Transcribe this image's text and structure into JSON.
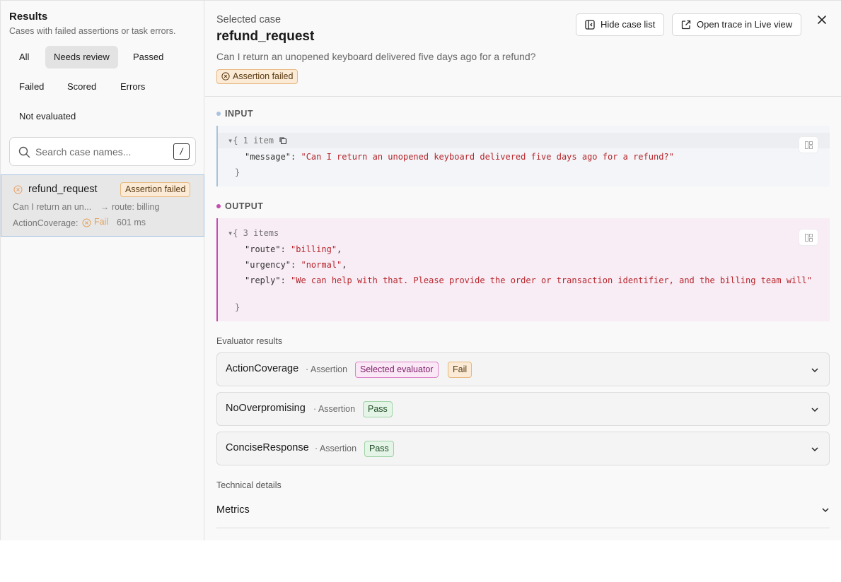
{
  "sidebar": {
    "title": "Results",
    "subtitle": "Cases with failed assertions or task errors.",
    "filters": [
      "All",
      "Needs review",
      "Passed",
      "Failed",
      "Scored",
      "Errors",
      "Not evaluated"
    ],
    "active_filter": "Needs review",
    "search": {
      "placeholder": "Search case names...",
      "shortcut": "/"
    },
    "case": {
      "name": "refund_request",
      "badge": "Assertion failed",
      "message_preview": "Can I return an un...",
      "route": "route: billing",
      "evaluator": "ActionCoverage:",
      "evaluator_result": "Fail",
      "duration": "601 ms"
    }
  },
  "detail": {
    "label": "Selected case",
    "title": "refund_request",
    "question": "Can I return an unopened keyboard delivered five days ago for a refund?",
    "badge": "Assertion failed",
    "hide_button": "Hide case list",
    "open_button": "Open trace in Live view",
    "input": {
      "label": "INPUT",
      "summary": "{ 1 item",
      "key": "\"message\"",
      "value": "\"Can I return an unopened keyboard delivered five days ago for a refund?\""
    },
    "output": {
      "label": "OUTPUT",
      "summary": "{ 3 items",
      "rows": [
        {
          "key": "\"route\"",
          "value": "\"billing\"",
          "trail": ","
        },
        {
          "key": "\"urgency\"",
          "value": "\"normal\"",
          "trail": ","
        },
        {
          "key": "\"reply\"",
          "value": "\"We can help with that. Please provide the order or transaction identifier, and the billing team will\"",
          "trail": ""
        }
      ]
    },
    "evaluator_title": "Evaluator results",
    "evaluators": [
      {
        "name": "ActionCoverage",
        "kind": "· Assertion",
        "selected": "Selected evaluator",
        "result": "Fail"
      },
      {
        "name": "NoOverpromising",
        "kind": "· Assertion",
        "result": "Pass"
      },
      {
        "name": "ConciseResponse",
        "kind": "· Assertion",
        "result": "Pass"
      }
    ],
    "technical_title": "Technical details",
    "metrics_label": "Metrics"
  },
  "colors": {
    "fail": "#e3a15c",
    "input_accent": "#a9c2de",
    "output_accent": "#c64cb0",
    "string": "#b7262c"
  }
}
